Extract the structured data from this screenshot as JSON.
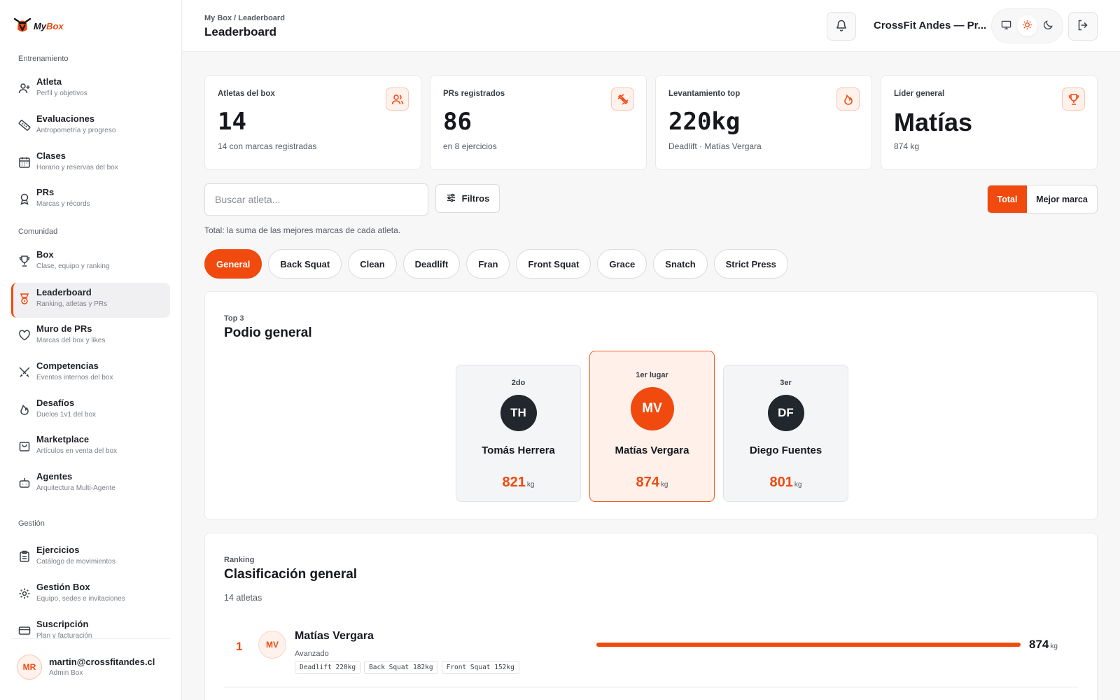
{
  "brand": {
    "name_prefix": "My",
    "name_accent": "Box"
  },
  "sidebar": {
    "sections": [
      {
        "title": "Entrenamiento",
        "items": [
          {
            "label": "Atleta",
            "sub": "Perfil y objetivos",
            "icon": "user-plus-icon"
          },
          {
            "label": "Evaluaciones",
            "sub": "Antropometría y progreso",
            "icon": "ruler-icon"
          },
          {
            "label": "Clases",
            "sub": "Horario y reservas del box",
            "icon": "calendar-icon"
          },
          {
            "label": "PRs",
            "sub": "Marcas y récords",
            "icon": "award-icon"
          }
        ]
      },
      {
        "title": "Comunidad",
        "items": [
          {
            "label": "Box",
            "sub": "Clase, equipo y ranking",
            "icon": "trophy-icon"
          },
          {
            "label": "Leaderboard",
            "sub": "Ranking, atletas y PRs",
            "icon": "medal-icon"
          },
          {
            "label": "Muro de PRs",
            "sub": "Marcas del box y likes",
            "icon": "heart-icon"
          },
          {
            "label": "Competencias",
            "sub": "Eventos internos del box",
            "icon": "swords-icon"
          },
          {
            "label": "Desafíos",
            "sub": "Duelos 1v1 del box",
            "icon": "flame-icon"
          },
          {
            "label": "Marketplace",
            "sub": "Artículos en venta del box",
            "icon": "shopping-bag-icon"
          },
          {
            "label": "Agentes",
            "sub": "Arquitectura Multi-Agente",
            "icon": "bot-icon"
          }
        ]
      },
      {
        "title": "Gestión",
        "items": [
          {
            "label": "Ejercicios",
            "sub": "Catálogo de movimientos",
            "icon": "clipboard-icon"
          },
          {
            "label": "Gestión Box",
            "sub": "Equipo, sedes e invitaciones",
            "icon": "gear-icon"
          },
          {
            "label": "Suscripción",
            "sub": "Plan y facturación",
            "icon": "credit-card-icon"
          }
        ]
      }
    ],
    "active_item": "Leaderboard",
    "user": {
      "initials": "MR",
      "email": "martin@crossfitandes.cl",
      "role": "Admin Box"
    }
  },
  "header": {
    "breadcrumb": "My Box / Leaderboard",
    "title": "Leaderboard",
    "box_name": "CrossFit Andes — Pr...",
    "theme_selected": "light"
  },
  "stats": [
    {
      "label": "Atletas del box",
      "value": "14",
      "sub": "14 con marcas registradas",
      "icon": "users-icon"
    },
    {
      "label": "PRs registrados",
      "value": "86",
      "sub": "en 8 ejercicios",
      "icon": "dumbbell-icon"
    },
    {
      "label": "Levantamiento top",
      "value": "220kg",
      "sub": "Deadlift · Matías Vergara",
      "icon": "flame-icon"
    },
    {
      "label": "Líder general",
      "value": "Matías",
      "sub": "874 kg",
      "icon": "trophy-icon"
    }
  ],
  "controls": {
    "search_placeholder": "Buscar atleta...",
    "filter_label": "Filtros",
    "mode_options": [
      "Total",
      "Mejor marca"
    ],
    "mode_selected": "Total",
    "hint": "Total: la suma de las mejores marcas de cada atleta."
  },
  "chips": [
    "General",
    "Back Squat",
    "Clean",
    "Deadlift",
    "Fran",
    "Front Squat",
    "Grace",
    "Snatch",
    "Strict Press"
  ],
  "chip_selected": "General",
  "podium": {
    "eyebrow": "Top 3",
    "title": "Podio general",
    "places": [
      {
        "position": "2do",
        "initials": "TH",
        "name": "Tomás Herrera",
        "score": "821",
        "unit": "kg"
      },
      {
        "position": "1er lugar",
        "initials": "MV",
        "name": "Matías Vergara",
        "score": "874",
        "unit": "kg"
      },
      {
        "position": "3er",
        "initials": "DF",
        "name": "Diego Fuentes",
        "score": "801",
        "unit": "kg"
      }
    ]
  },
  "ranking": {
    "eyebrow": "Ranking",
    "title": "Clasificación general",
    "count_label": "14 atletas",
    "rows": [
      {
        "rank": "1",
        "initials": "MV",
        "name": "Matías Vergara",
        "level": "Avanzado",
        "tags": [
          "Deadlift 220kg",
          "Back Squat 182kg",
          "Front Squat 152kg"
        ],
        "value": "874",
        "unit": "kg",
        "fraction": 1.0
      }
    ]
  },
  "colors": {
    "accent": "#f04a0e",
    "dark_avatar": "#22262d"
  }
}
